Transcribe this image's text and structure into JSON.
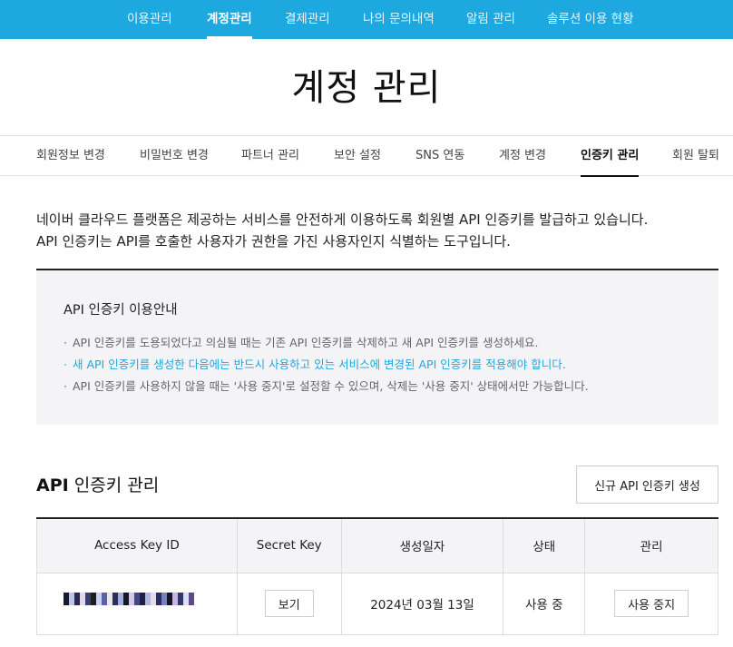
{
  "top_nav": {
    "items": [
      {
        "label": "이용관리",
        "active": false
      },
      {
        "label": "계정관리",
        "active": true
      },
      {
        "label": "결제관리",
        "active": false
      },
      {
        "label": "나의 문의내역",
        "active": false
      },
      {
        "label": "알림 관리",
        "active": false
      },
      {
        "label": "솔루션 이용 현황",
        "active": false
      }
    ]
  },
  "page": {
    "title": "계정 관리"
  },
  "sub_tabs": {
    "items": [
      {
        "label": "회원정보 변경",
        "active": false
      },
      {
        "label": "비밀번호 변경",
        "active": false
      },
      {
        "label": "파트너 관리",
        "active": false
      },
      {
        "label": "보안 설정",
        "active": false
      },
      {
        "label": "SNS 연동",
        "active": false
      },
      {
        "label": "계정 변경",
        "active": false
      },
      {
        "label": "인증키 관리",
        "active": true
      },
      {
        "label": "회원 탈퇴",
        "active": false
      }
    ]
  },
  "intro": {
    "line1": "네이버 클라우드 플랫폼은 제공하는 서비스를 안전하게 이용하도록 회원별 API 인증키를 발급하고 있습니다.",
    "line2": "API 인증키는 API를 호출한 사용자가 권한을 가진 사용자인지 식별하는 도구입니다."
  },
  "guide": {
    "title": "API 인증키 이용안내",
    "items": [
      {
        "text": "API 인증키를 도용되었다고 의심될 때는 기존 API 인증키를 삭제하고 새 API 인증키를 생성하세요.",
        "highlight": false
      },
      {
        "text": "새 API 인증키를 생성한 다음에는 반드시 사용하고 있는 서비스에 변경된 API 인증키를 적용해야 합니다.",
        "highlight": true
      },
      {
        "text": "API 인증키를 사용하지 않을 때는 '사용 중지'로 설정할 수 있으며, 삭제는 '사용 중지' 상태에서만 가능합니다.",
        "highlight": false
      }
    ]
  },
  "key_section": {
    "title_bold": "API",
    "title_rest": " 인증키 관리",
    "new_key_button": "신규 API 인증키 생성",
    "columns": [
      "Access Key ID",
      "Secret Key",
      "생성일자",
      "상태",
      "관리"
    ],
    "rows": [
      {
        "access_key_masked": true,
        "secret_key_button": "보기",
        "created": "2024년 03월 13일",
        "status": "사용 중",
        "action_button": "사용 중지"
      }
    ]
  },
  "colors": {
    "accent": "#1ea8e0",
    "text": "#222222",
    "muted": "#666666",
    "panel_bg": "#f4f4f6"
  }
}
